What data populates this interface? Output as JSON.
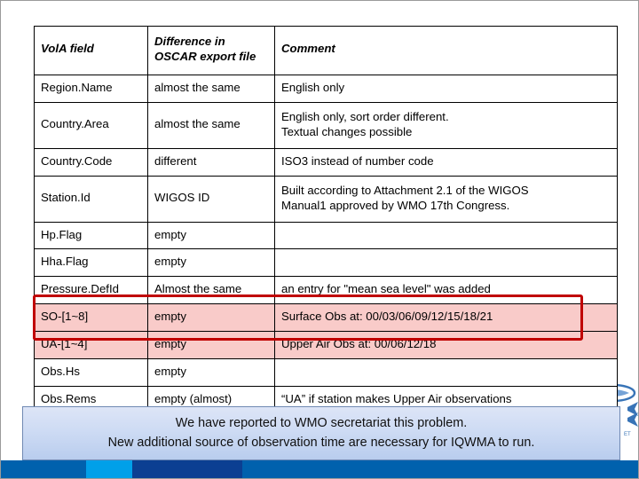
{
  "table": {
    "headers": [
      "VolA field",
      "Difference in OSCAR export file",
      "Comment"
    ],
    "header_col2_line1": "Difference in",
    "header_col2_line2": "OSCAR export file",
    "rows": [
      {
        "field": "Region.Name",
        "difference": "almost the same",
        "comment": "English only",
        "comment_line2": "",
        "highlighted": false
      },
      {
        "field": "Country.Area",
        "difference": "almost the same",
        "comment": "English only, sort order different.",
        "comment_line2": "Textual changes possible",
        "highlighted": false
      },
      {
        "field": "Country.Code",
        "difference": "different",
        "comment": "ISO3 instead of number code",
        "comment_line2": "",
        "highlighted": false
      },
      {
        "field": "Station.Id",
        "difference": "WIGOS ID",
        "comment": "Built according to Attachment 2.1 of the WIGOS",
        "comment_line2": "Manual1 approved by WMO 17th Congress.",
        "highlighted": false
      },
      {
        "field": "Hp.Flag",
        "difference": "empty",
        "comment": "",
        "comment_line2": "",
        "highlighted": false
      },
      {
        "field": "Hha.Flag",
        "difference": "empty",
        "comment": "",
        "comment_line2": "",
        "highlighted": false
      },
      {
        "field": "Pressure.DefId",
        "difference": "Almost the same",
        "comment": "an entry for \"mean sea level\" was added",
        "comment_line2": "",
        "highlighted": false
      },
      {
        "field": "SO-[1~8]",
        "difference": "empty",
        "comment": "Surface Obs at: 00/03/06/09/12/15/18/21",
        "comment_line2": "",
        "highlighted": true
      },
      {
        "field": "UA-[1~4]",
        "difference": "empty",
        "comment": "Upper Air Obs at: 00/06/12/18",
        "comment_line2": "",
        "highlighted": true
      },
      {
        "field": "Obs.Hs",
        "difference": "empty",
        "comment": "",
        "comment_line2": "",
        "highlighted": false
      },
      {
        "field": "Obs.Rems",
        "difference": "empty (almost)",
        "comment": "“UA” if station makes Upper Air observations",
        "comment_line2": "",
        "highlighted": false
      }
    ]
  },
  "callout": {
    "line1": "We have reported to WMO secretariat this problem.",
    "line2": "New additional source of observation time are necessary for IQWMA to run."
  },
  "colors": {
    "highlight_fill": "#f9cbc9",
    "highlight_border": "#c00000",
    "callout_border": "#7089b3",
    "bar_blue": "#0061ad",
    "bar_cyan": "#00a0e9",
    "bar_navy": "#0b3f92"
  }
}
